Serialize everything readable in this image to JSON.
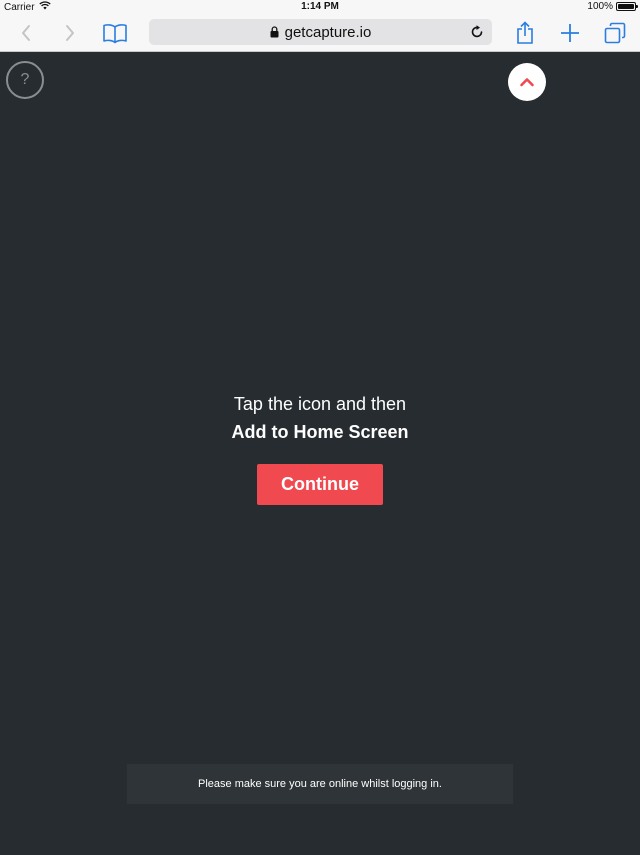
{
  "status_bar": {
    "carrier": "Carrier",
    "time": "1:14 PM",
    "battery": "100%",
    "battery_level": 1.0
  },
  "browser": {
    "url": "getcapture.io",
    "icons": {
      "back": "chevron-left-icon",
      "forward": "chevron-right-icon",
      "bookmarks": "book-icon",
      "lock": "lock-icon",
      "reload": "reload-icon",
      "share": "share-icon",
      "new_tab": "plus-icon",
      "tabs": "tabs-icon"
    },
    "accent_color": "#2a7de1"
  },
  "page": {
    "help_label": "?",
    "message_line1": "Tap the icon and then",
    "message_line2": "Add to Home Screen",
    "continue_label": "Continue",
    "notice": "Please make sure you are online whilst logging in.",
    "colors": {
      "background": "#262c30",
      "button": "#f0494f",
      "up_arrow": "#f0494f"
    }
  }
}
